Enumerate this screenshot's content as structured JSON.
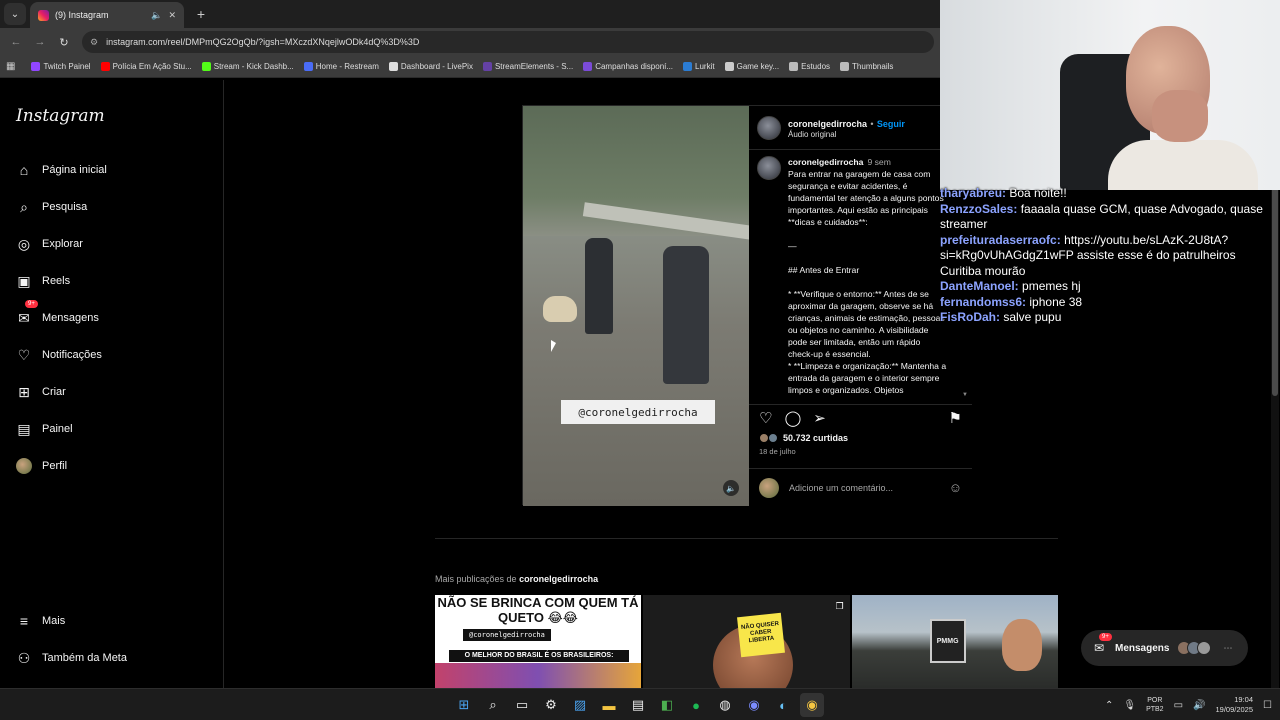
{
  "browser": {
    "tab_title": "(9) Instagram",
    "url": "instagram.com/reel/DMPmQG2OgQb/?igsh=MXczdXNqejlwODk4dQ%3D%3D",
    "bookmarks": [
      {
        "label": "Twitch Painel",
        "color": "#9146ff"
      },
      {
        "label": "Polícia Em Ação Stu...",
        "color": "#ff0000"
      },
      {
        "label": "Stream - Kick Dashb...",
        "color": "#53fc18"
      },
      {
        "label": "Home - Restream",
        "color": "#4a6cf7"
      },
      {
        "label": "Dashboard - LivePix",
        "color": "#dddddd"
      },
      {
        "label": "StreamElements - S...",
        "color": "#6441a5"
      },
      {
        "label": "Campanhas disponí...",
        "color": "#7b4bd8"
      },
      {
        "label": "Lurkit",
        "color": "#2b7cd3"
      },
      {
        "label": "Game key...",
        "color": "#cccccc"
      },
      {
        "label": "Estudos",
        "color": "#bbbbbb"
      },
      {
        "label": "Thumbnails",
        "color": "#bbbbbb"
      }
    ]
  },
  "sidebar": {
    "logo": "Instagram",
    "items": [
      {
        "label": "Página inicial",
        "icon": "home-icon",
        "glyph": "⌂"
      },
      {
        "label": "Pesquisa",
        "icon": "search-icon",
        "glyph": "⌕"
      },
      {
        "label": "Explorar",
        "icon": "compass-icon",
        "glyph": "◎"
      },
      {
        "label": "Reels",
        "icon": "reels-icon",
        "glyph": "▣"
      },
      {
        "label": "Mensagens",
        "icon": "messenger-icon",
        "glyph": "✉",
        "badge": "9+"
      },
      {
        "label": "Notificações",
        "icon": "heart-icon",
        "glyph": "♡"
      },
      {
        "label": "Criar",
        "icon": "plus-square-icon",
        "glyph": "⊞"
      },
      {
        "label": "Painel",
        "icon": "dashboard-icon",
        "glyph": "▤"
      },
      {
        "label": "Perfil",
        "icon": "profile-avatar",
        "glyph": ""
      }
    ],
    "bottom": [
      {
        "label": "Mais",
        "icon": "hamburger-icon",
        "glyph": "≡"
      },
      {
        "label": "Também da Meta",
        "icon": "meta-icon",
        "glyph": "⚇"
      }
    ]
  },
  "post": {
    "watermark": "@coronelgedirrocha",
    "username": "coronelgedirrocha",
    "dot": "•",
    "follow": "Seguir",
    "audio": "Áudio original",
    "caption_user": "coronelgedirrocha",
    "caption_time": "9 sem",
    "caption_text": "Para entrar na garagem de casa com segurança e evitar acidentes, é fundamental ter atenção a alguns pontos importantes. Aqui estão as principais **dicas e cuidados**:\n\n—\n\n## Antes de Entrar\n\n* **Verifique o entorno:** Antes de se aproximar da garagem, observe se há crianças, animais de estimação, pessoas ou objetos no caminho. A visibilidade pode ser limitada, então um rápido check-up é essencial.\n* **Limpeza e organização:** Mantenha a entrada da garagem e o interior sempre limpos e organizados. Objetos",
    "likes": "50.732 curtidas",
    "date": "18 de julho",
    "comment_placeholder": "Adicione um comentário..."
  },
  "more": {
    "prefix": "Mais publicações de",
    "user": "coronelgedirrocha",
    "thumb1_text": "NÃO SE BRINCA COM QUEM TÁ QUETO 😂😂",
    "thumb1_tag": "@coronelgedirrocha",
    "thumb1_bar": "O MELHOR DO BRASIL É OS BRASILEIROS:",
    "thumb2_note": "NÃO QUISER CABER LIBERTA",
    "thumb3_badge": "PMMG"
  },
  "messages_bubble": {
    "label": "Mensagens",
    "badge": "9+"
  },
  "chat": [
    {
      "user": "tharyabreu:",
      "text": "Boa noite!!"
    },
    {
      "user": "RenzzoSales:",
      "text": "faaaala quase GCM, quase Advogado, quase streamer"
    },
    {
      "user": "prefeituradaserraofc:",
      "text": "https://youtu.be/sLAzK-2U8tA?si=kRg0vUhAGdgZ1wFP assiste esse é do patrulheiros Curitiba mourão"
    },
    {
      "user": "DanteManoel:",
      "text": "pmemes hj"
    },
    {
      "user": "fernandomss6:",
      "text": "iphone 38"
    },
    {
      "user": "FisRoDah:",
      "text": "salve pupu"
    }
  ],
  "taskbar": {
    "lang_top": "POR",
    "lang_bottom": "PTB2",
    "time": "19:04",
    "date": "19/09/2025"
  }
}
